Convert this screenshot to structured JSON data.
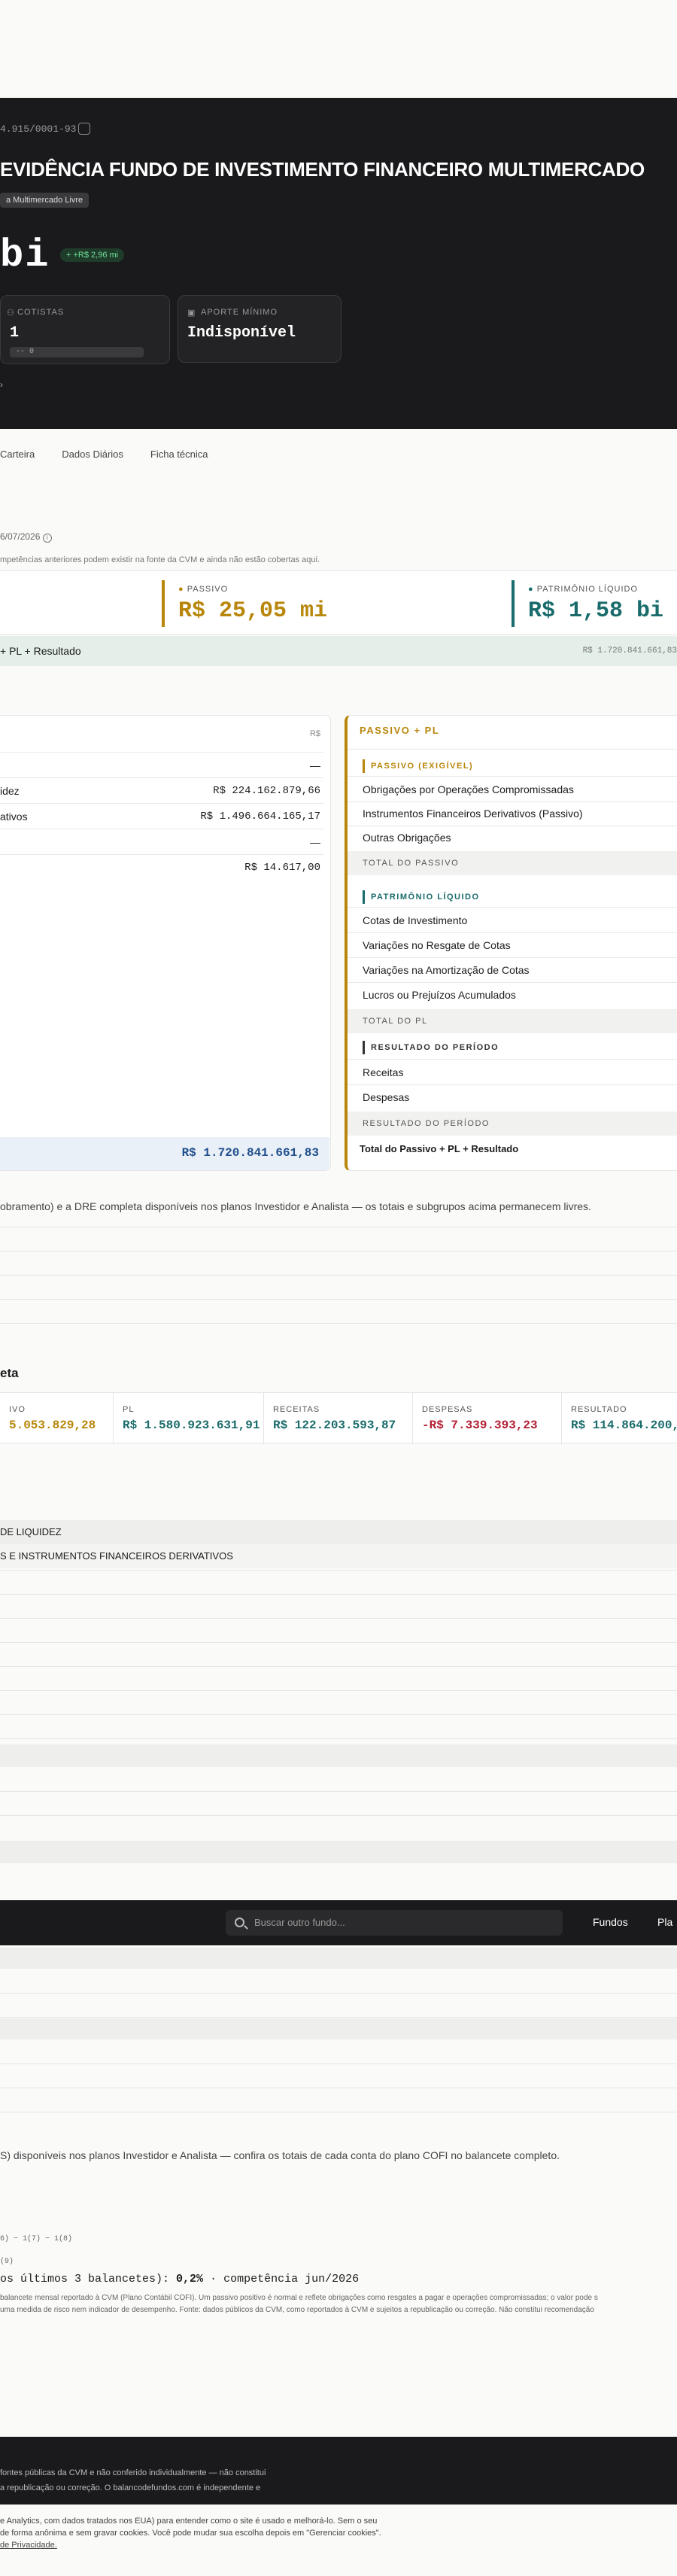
{
  "hero": {
    "cnpj": "4.915/0001-93",
    "title": "EVIDÊNCIA FUNDO DE INVESTIMENTO FINANCEIRO MULTIMERCADO",
    "tag": "a Multimercado Livre",
    "big_value": "bi",
    "delta": "+ +R$ 2,96 mi",
    "cotistas_label": "COTISTAS",
    "cotistas_value": "1",
    "cotistas_sub": "-- 0",
    "aporte_label": "APORTE MÍNIMO",
    "aporte_value": "Indisponível",
    "chevron": "›"
  },
  "tabs": [
    "Carteira",
    "Dados Diários",
    "Ficha técnica"
  ],
  "date": "6/07/2026",
  "note1": "mpetências anteriores podem existir na fonte da CVM e ainda não estão cobertas aqui.",
  "kpi": {
    "passivo_label": "PASSIVO",
    "passivo_value": "R$ 25,05 mi",
    "pl_label": "PATRIMÔNIO LÍQUIDO",
    "pl_value": "R$ 1,58 bi"
  },
  "strip": {
    "label": "+ PL + Resultado",
    "right": "R$ 1.720.841.661,83"
  },
  "ativo": {
    "currency": "R$",
    "dash1": "—",
    "row1_label": "idez",
    "row1_value": "R$ 224.162.879,66",
    "row2_label": "ativos",
    "row2_value": "R$ 1.496.664.165,17",
    "dash2": "—",
    "row3_value": "R$ 14.617,00",
    "total": "R$ 1.720.841.661,83"
  },
  "passivo": {
    "header": "PASSIVO + PL",
    "sub1": "PASSIVO (EXIGÍVEL)",
    "items1": [
      "Obrigações por Operações Compromissadas",
      "Instrumentos Financeiros Derivativos (Passivo)",
      "Outras Obrigações"
    ],
    "total1": "TOTAL DO PASSIVO",
    "sub2": "PATRIMÔNIO LÍQUIDO",
    "items2": [
      "Cotas de Investimento",
      "Variações no Resgate de Cotas",
      "Variações na Amortização de Cotas",
      "Lucros ou Prejuízos Acumulados"
    ],
    "total2": "TOTAL DO PL",
    "sub3": "RESULTADO DO PERÍODO",
    "items3": [
      "Receitas",
      "Despesas"
    ],
    "total3": "RESULTADO DO PERÍODO",
    "grand": "Total do Passivo + PL + Resultado"
  },
  "note2": "obramento) e a DRE completa disponíveis nos planos Investidor e Analista — os totais e subgrupos acima permanecem livres.",
  "dre": {
    "title": "eta",
    "cols": [
      {
        "k": "IVO",
        "v": "5.053.829,28"
      },
      {
        "k": "PL",
        "v": "R$ 1.580.923.631,91"
      },
      {
        "k": "RECEITAS",
        "v": "R$ 122.203.593,87"
      },
      {
        "k": "DESPESAS",
        "v": "-R$ 7.339.393,23"
      },
      {
        "k": "RESULTADO",
        "v": "R$ 114.864.200,64"
      }
    ]
  },
  "bands": {
    "b1": "DE LIQUIDEZ",
    "b2": "S E INSTRUMENTOS FINANCEIROS DERIVATIVOS"
  },
  "nav": {
    "search_placeholder": "Buscar outro fundo...",
    "link1": "Fundos",
    "link2": "Pla"
  },
  "note3": "S) disponíveis nos planos Investidor e Analista — confira os totais de cada conta do plano COFI no balancete completo.",
  "formula1": "6) − 1(7) − 1(8)",
  "formula2": "(9)",
  "summary": {
    "prefix": "os últimos 3 balancetes): ",
    "value": "0,2%",
    "suffix": " · competência jun/2026"
  },
  "disc1": "balancete mensal reportado à CVM (Plano Contábil COFI). Um passivo positivo é normal e reflete obrigações como resgates a pagar e operações compromissadas; o valor pode s",
  "disc2": "uma medida de risco nem indicador de desempenho. Fonte: dados públicos da CVM, como reportados à CVM e sujeitos a republicação ou correção. Não constitui recomendação",
  "footer1": "fontes públicas da CVM e não conferido individualmente — não constitui",
  "footer2": "a republicação ou correção. O balancodefundos.com é independente e",
  "cookie1": "e Analytics, com dados tratados nos EUA) para entender como o site é usado e melhorá-lo. Sem o seu",
  "cookie2": "de forma anônima e sem gravar cookies. Você pode mudar sua escolha depois em \"Gerenciar cookies\".",
  "cookie3": "de Privacidade."
}
